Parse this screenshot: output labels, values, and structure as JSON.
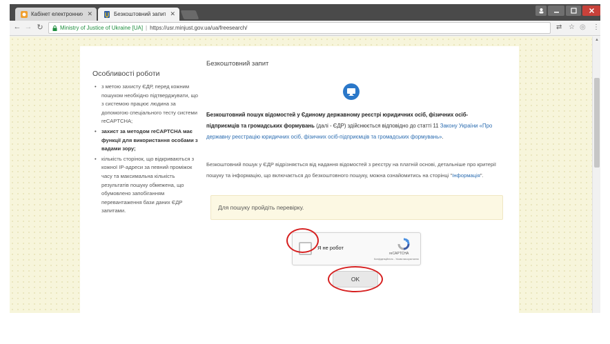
{
  "browser": {
    "tabs": [
      {
        "title": "Кабінет електронних се",
        "active": false
      },
      {
        "title": "Безкоштовний запит | М",
        "active": true
      }
    ],
    "omnibox": {
      "site_name": "Ministry of Justice of Ukraine [UA]",
      "separator": "|",
      "url": "https://usr.minjust.gov.ua/ua/freesearch/"
    },
    "icons": {
      "back": "arrow-left-icon",
      "forward": "arrow-right-icon",
      "reload": "reload-icon",
      "lock": "lock-icon",
      "translate": "translate-icon",
      "bookmark": "star-icon",
      "menu": "kebab-menu-icon"
    }
  },
  "sidebar": {
    "title": "Особливості роботи",
    "items": [
      {
        "text": "з метою захисту ЄДР, перед кожним пошуком необхідно підтверджувати, що з системою працює людина за допомогою спеціального тесту системи reCAPTCHA;",
        "bold": false
      },
      {
        "text": "захист за методом reCAPTCHA має функції для використання особами з вадами зору;",
        "bold": true
      },
      {
        "text": "кількість сторінок, що відкриваються з кожної IP-адреси за певний проміжок часу та максимальна кількість результатів пошуку обмежена, що обумовлено запобіганням перевантаження бази даних ЄДР запитами.",
        "bold": false
      }
    ]
  },
  "main": {
    "title": "Безкоштовний запит",
    "intro_bold": "Безкоштовний пошук відомостей у Єдиному державному реєстрі юридичних осіб, фізичних осіб-підприємців та громадських формувань",
    "intro_plain": " (далі - ЄДР) здійснюється відповідно до статті 11 ",
    "intro_link": "Закону України «Про державну реєстрацію юридичних осіб, фізичних осіб-підприємців та громадських формувань»",
    "intro_end": ".",
    "p2_text": "Безкоштовний пошук у ЄДР відрізняється від надання відомостей з реєстру на платній основі, детальніше про критерії пошуку та інформацію, що включається до безкоштовного пошуку, можна ознайомитись на сторінці \"",
    "p2_link": "Інформація",
    "p2_end": "\".",
    "notice": "Для пошуку пройдіть перевірку.",
    "captcha": {
      "label": "Я не робот",
      "brand": "reCAPTCHA",
      "links": "Конфіденційність - Умови використання"
    },
    "ok_label": "OK"
  },
  "colors": {
    "accent_blue": "#2b78c9",
    "highlight_red": "#d62020",
    "notice_bg": "#fcf8e3",
    "page_bg": "#f7f5db"
  }
}
